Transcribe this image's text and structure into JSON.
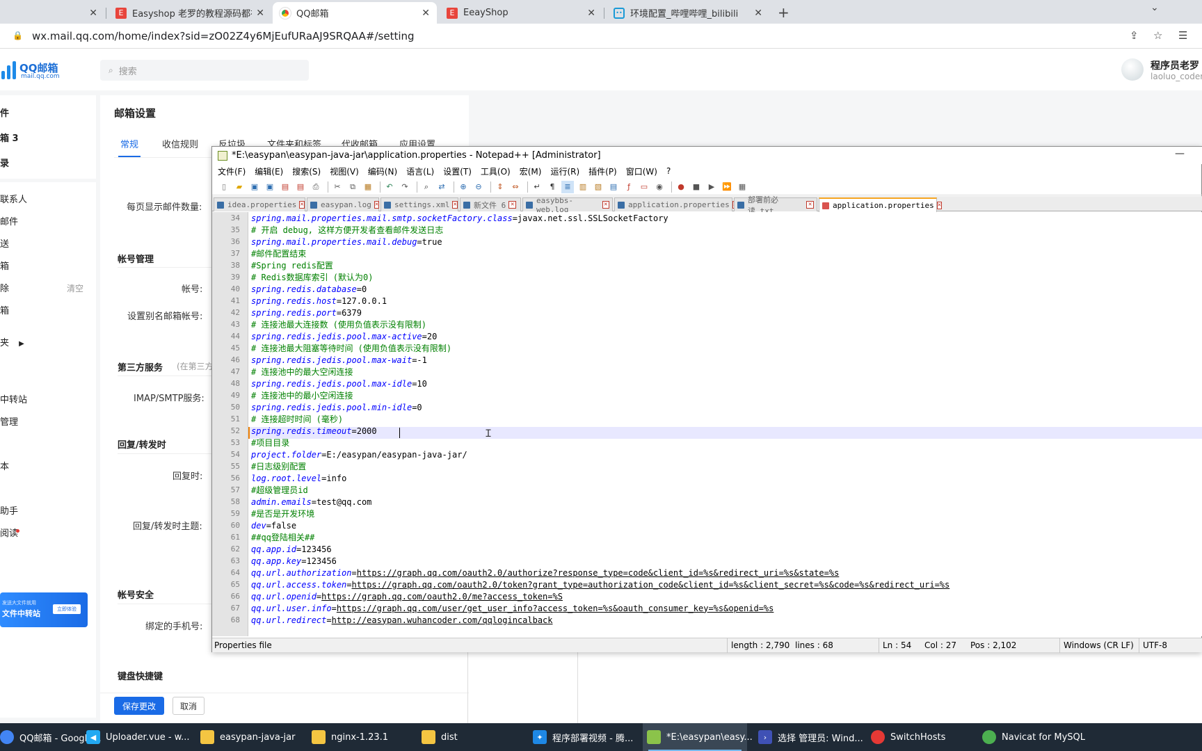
{
  "browser": {
    "tabs": [
      {
        "title": "",
        "active": false
      },
      {
        "title": "Easyshop 老罗的教程源码都在这",
        "active": false
      },
      {
        "title": "QQ邮箱",
        "active": true
      },
      {
        "title": "EeayShop",
        "active": false
      },
      {
        "title": "环境配置_哔哩哔哩_bilibili",
        "active": false
      }
    ],
    "url": "wx.mail.qq.com/home/index?sid=zO02Z4y6MjEufURaAJ9SRQAA#/setting"
  },
  "qqmail": {
    "logo_main": "QQ邮箱",
    "logo_sub": "mail.qq.com",
    "search_placeholder": "搜索",
    "user_name": "程序员老罗",
    "user_account": "laoluo_coder",
    "sidebar": [
      "件",
      "箱 3",
      "录",
      "联系人",
      "邮件",
      "送",
      "箱",
      "除",
      "箱",
      "夹",
      "中转站",
      "管理",
      "本",
      "助手",
      "阅读"
    ],
    "sidebar_clear": "清空",
    "banner_small": "发送大文件就用",
    "banner_title": "文件中转站",
    "banner_btn": "立即体验",
    "page_title": "邮箱设置",
    "settings_tabs": [
      "常规",
      "收信规则",
      "反垃圾",
      "文件夹和标签",
      "代收邮箱",
      "应用设置"
    ],
    "labels": {
      "per_page": "每页显示邮件数量:",
      "account_mgmt": "帐号管理",
      "account": "帐号:",
      "alias": "设置别名邮箱帐号:",
      "third_party": "第三方服务",
      "third_party_sub": "(在第三方",
      "imap": "IMAP/SMTP服务:",
      "reply_fwd": "回复/转发时",
      "reply_when": "回复时:",
      "reply_subject": "回复/转发时主题:",
      "security": "帐号安全",
      "phone": "绑定的手机号:",
      "shortcuts": "键盘快捷键"
    },
    "save_btn": "保存更改",
    "cancel_btn": "取消"
  },
  "notepad": {
    "title": "*E:\\easypan\\easypan-java-jar\\application.properties - Notepad++ [Administrator]",
    "menu": [
      "文件(F)",
      "编辑(E)",
      "搜索(S)",
      "视图(V)",
      "编码(N)",
      "语言(L)",
      "设置(T)",
      "工具(O)",
      "宏(M)",
      "运行(R)",
      "插件(P)",
      "窗口(W)",
      "?"
    ],
    "file_tabs": [
      {
        "name": "idea.properties",
        "active": false
      },
      {
        "name": "easypan.log",
        "active": false
      },
      {
        "name": "settings.xml",
        "active": false
      },
      {
        "name": "新文件 6",
        "active": false
      },
      {
        "name": "easybbs-web.log",
        "active": false
      },
      {
        "name": "application.properties",
        "active": false
      },
      {
        "name": "部署前必读.txt",
        "active": false
      },
      {
        "name": "application.properties",
        "active": true
      }
    ],
    "lines": [
      {
        "n": "34",
        "t": "kv",
        "k": "spring.mail.properties.mail.smtp.socketFactory.class",
        "v": "javax.net.ssl.SSLSocketFactory"
      },
      {
        "n": "35",
        "t": "c",
        "text": "# 开启 debug, 这样方便开发者查看邮件发送日志"
      },
      {
        "n": "36",
        "t": "kv",
        "k": "spring.mail.properties.mail.debug",
        "v": "true"
      },
      {
        "n": "37",
        "t": "c",
        "text": "#邮件配置结束"
      },
      {
        "n": "38",
        "t": "c",
        "text": "#Spring redis配置"
      },
      {
        "n": "39",
        "t": "c",
        "text": "# Redis数据库索引 (默认为0)"
      },
      {
        "n": "40",
        "t": "kv",
        "k": "spring.redis.database",
        "v": "0"
      },
      {
        "n": "41",
        "t": "kv",
        "k": "spring.redis.host",
        "v": "127.0.0.1"
      },
      {
        "n": "42",
        "t": "kv",
        "k": "spring.redis.port",
        "v": "6379"
      },
      {
        "n": "43",
        "t": "c",
        "text": "# 连接池最大连接数 (使用负值表示没有限制)"
      },
      {
        "n": "44",
        "t": "kv",
        "k": "spring.redis.jedis.pool.max-active",
        "v": "20"
      },
      {
        "n": "45",
        "t": "c",
        "text": "# 连接池最大阻塞等待时间 (使用负值表示没有限制)"
      },
      {
        "n": "46",
        "t": "kv",
        "k": "spring.redis.jedis.pool.max-wait",
        "v": "-1"
      },
      {
        "n": "47",
        "t": "c",
        "text": "# 连接池中的最大空闲连接"
      },
      {
        "n": "48",
        "t": "kv",
        "k": "spring.redis.jedis.pool.max-idle",
        "v": "10"
      },
      {
        "n": "49",
        "t": "c",
        "text": "# 连接池中的最小空闲连接"
      },
      {
        "n": "50",
        "t": "kv",
        "k": "spring.redis.jedis.pool.min-idle",
        "v": "0"
      },
      {
        "n": "51",
        "t": "c",
        "text": "# 连接超时时间 (毫秒)"
      },
      {
        "n": "52",
        "t": "kv",
        "k": "spring.redis.timeout",
        "v": "2000"
      },
      {
        "n": "53",
        "t": "c",
        "text": "#项目目录"
      },
      {
        "n": "54",
        "t": "kv",
        "k": "project.folder",
        "v": "E:/easypan/easypan-java-jar/"
      },
      {
        "n": "55",
        "t": "c",
        "text": "#日志级别配置"
      },
      {
        "n": "56",
        "t": "kv",
        "k": "log.root.level",
        "v": "info"
      },
      {
        "n": "57",
        "t": "c",
        "text": "#超级管理员id"
      },
      {
        "n": "58",
        "t": "kv",
        "k": "admin.emails",
        "v": "test@qq.com"
      },
      {
        "n": "59",
        "t": "c",
        "text": "#是否是开发环境"
      },
      {
        "n": "60",
        "t": "kv",
        "k": "dev",
        "v": "false"
      },
      {
        "n": "61",
        "t": "c",
        "text": "##qq登陆相关##"
      },
      {
        "n": "62",
        "t": "kv",
        "k": "qq.app.id",
        "v": "123456"
      },
      {
        "n": "63",
        "t": "kv",
        "k": "qq.app.key",
        "v": "123456"
      },
      {
        "n": "64",
        "t": "ku",
        "k": "qq.url.authorization",
        "v": "https://graph.qq.com/oauth2.0/authorize?response_type=code&client_id=%s&redirect_uri=%s&state=%s"
      },
      {
        "n": "65",
        "t": "ku",
        "k": "qq.url.access.token",
        "v": "https://graph.qq.com/oauth2.0/token?grant_type=authorization_code&client_id=%s&client_secret=%s&code=%s&redirect_uri=%s"
      },
      {
        "n": "66",
        "t": "ku",
        "k": "qq.url.openid",
        "v": "https://graph.qq.com/oauth2.0/me?access_token=%S"
      },
      {
        "n": "67",
        "t": "ku",
        "k": "qq.url.user.info",
        "v": "https://graph.qq.com/user/get_user_info?access_token=%s&oauth_consumer_key=%s&openid=%s"
      },
      {
        "n": "68",
        "t": "ku",
        "k": "qq.url.redirect",
        "v": "http://easypan.wuhancoder.com/qqlogincalback"
      }
    ],
    "status": {
      "filetype": "Properties file",
      "length": "length : 2,790",
      "lines": "lines : 68",
      "ln": "Ln : 54",
      "col": "Col : 27",
      "pos": "Pos : 2,102",
      "eol": "Windows (CR LF)",
      "enc": "UTF-8"
    }
  },
  "taskbar": [
    {
      "label": "QQ邮箱 - Google...",
      "icon_color": "#4285f4"
    },
    {
      "label": "Uploader.vue - w...",
      "icon_color": "#23a9f2"
    },
    {
      "label": "easypan-java-jar",
      "icon_color": "#f4c542"
    },
    {
      "label": "nginx-1.23.1",
      "icon_color": "#f4c542"
    },
    {
      "label": "dist",
      "icon_color": "#f4c542"
    },
    {
      "label": "程序部署视频 - 腾...",
      "icon_color": "#1e88e5"
    },
    {
      "label": "*E:\\easypan\\easy...",
      "icon_color": "#8bc34a"
    },
    {
      "label": "选择 管理员: Wind...",
      "icon_color": "#3f51b5"
    },
    {
      "label": "SwitchHosts",
      "icon_color": "#e53935"
    },
    {
      "label": "Navicat for MySQL",
      "icon_color": "#4caf50"
    }
  ]
}
